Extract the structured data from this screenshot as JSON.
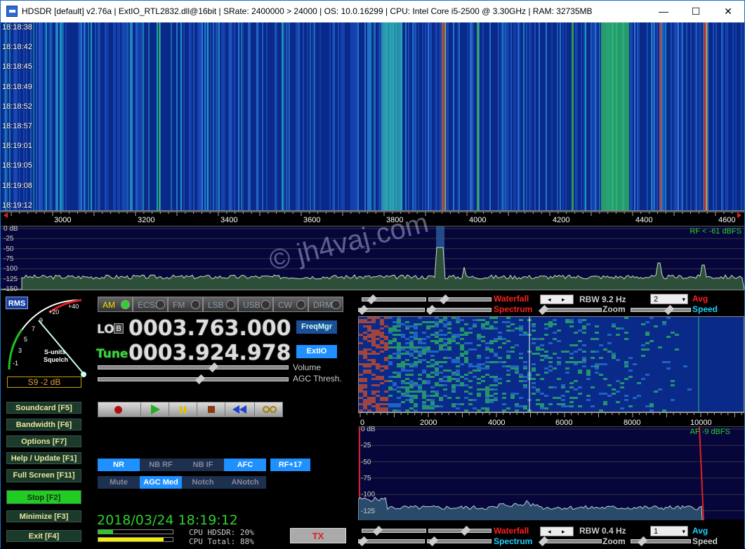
{
  "titlebar": {
    "title": "HDSDR  [default]  v2.76a  |  ExtIO_RTL2832.dll@16bit  |  SRate: 2400000 > 24000  |  OS: 10.0.16299   |  CPU: Intel Core i5-2500 @ 3.30GHz  |  RAM: 32735MB",
    "minimize": "—",
    "maximize": "☐",
    "close": "✕"
  },
  "waterfall": {
    "timestamps": [
      "18:18:38",
      "18:18:42",
      "18:18:45",
      "18:18:49",
      "18:18:52",
      "18:18:57",
      "18:19:01",
      "18:19:05",
      "18:19:08",
      "18:19:12"
    ]
  },
  "scale": {
    "labels": [
      "3000",
      "3200",
      "3400",
      "3600",
      "3800",
      "4000",
      "4200",
      "4400",
      "4600"
    ]
  },
  "spectrum": {
    "db_labels": [
      "0 dB",
      "-25",
      "-50",
      "-75",
      "-100",
      "-125",
      "-150"
    ],
    "rf_level": "RF < -61 dBFS"
  },
  "watermark": "© jh4vaj.com",
  "smeter": {
    "rms": "RMS",
    "scale_labels": [
      "-1",
      "3",
      "5",
      "7",
      "9",
      "+20",
      "+40"
    ],
    "caption1": "S-units",
    "caption2": "Squelch",
    "reading": "S9 -2 dB"
  },
  "modes": [
    "AM",
    "ECSS",
    "FM",
    "LSB",
    "USB",
    "CW",
    "DRM"
  ],
  "lo": {
    "label": "LO",
    "b": "B",
    "value": "0003.763.000"
  },
  "tune": {
    "label": "Tune",
    "value": "0003.924.978"
  },
  "buttons": {
    "freqmgr": "FreqMgr",
    "extio": "ExtIO",
    "volume": "Volume",
    "agc_thresh": "AGC Thresh."
  },
  "left_buttons": [
    {
      "label": "Soundcard  [F5]"
    },
    {
      "label": "Bandwidth  [F6]"
    },
    {
      "label": "Options    [F7]"
    },
    {
      "label": "Help / Update  [F1]"
    },
    {
      "label": "Full Screen  [F11]"
    },
    {
      "label": "Stop           [F2]"
    },
    {
      "label": "Minimize   [F3]"
    },
    {
      "label": "Exit           [F4]"
    }
  ],
  "dsp": {
    "nr": "NR",
    "nbrf": "NB RF",
    "nbif": "NB IF",
    "afc": "AFC",
    "rf17": "RF+17",
    "mute": "Mute",
    "agc": "AGC Med",
    "notch": "Notch",
    "anotch": "ANotch"
  },
  "datetime": "2018/03/24 18:19:12",
  "cpu": {
    "hdsdr": "CPU HDSDR: 20%",
    "total": "CPU Total: 88%",
    "hdsdr_pct": 20,
    "total_pct": 88
  },
  "tx": "TX",
  "top_ctrl": {
    "waterfall": "Waterfall",
    "spectrum": "Spectrum",
    "rbw": "RBW  9.2 Hz",
    "zoom": "Zoom",
    "avg_value": "2",
    "avg": "Avg",
    "speed": "Speed"
  },
  "af_scale": {
    "labels": [
      "0",
      "2000",
      "4000",
      "6000",
      "8000",
      "10000"
    ]
  },
  "af_spec": {
    "db_labels": [
      "0 dB",
      "-25",
      "-50",
      "-75",
      "-100",
      "-125"
    ],
    "af_level": "AF  -9 dBFS"
  },
  "bot_ctrl": {
    "waterfall": "Waterfall",
    "spectrum": "Spectrum",
    "rbw": "RBW  0.4 Hz",
    "zoom": "Zoom",
    "avg_value": "1",
    "avg": "Avg",
    "speed": "Speed"
  },
  "colors": {
    "accent_blue": "#1e90ff",
    "stop_green": "#22cc22",
    "tx_red": "#ff2020",
    "dig_white": "#dddddd",
    "tune_green": "#33dd33"
  }
}
